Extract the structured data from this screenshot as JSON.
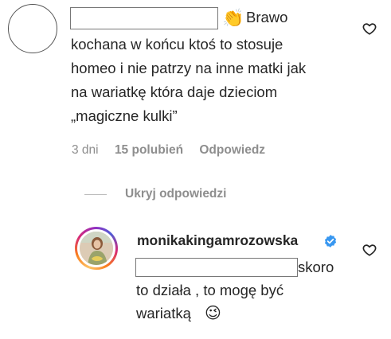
{
  "comment": {
    "redacted_username": "",
    "emoji": "👏",
    "text_line1_tail": "Brawo",
    "text_lines": [
      "kochana w końcu ktoś to stosuje",
      "homeo i nie patrzy na inne matki jak",
      "na wariatkę która daje dzieciom",
      "„magiczne kulki”"
    ],
    "time": "3 dni",
    "likes": "15 polubień",
    "reply_label": "Odpowiedz"
  },
  "toggle_replies": "Ukryj odpowiedzi",
  "reply": {
    "username": "monikakingamrozowska",
    "verified": true,
    "text_line1_tail": "skoro",
    "text_lines": [
      "to działa , to mogę być",
      "wariatką"
    ],
    "emoji": "😉"
  },
  "icons": {
    "like": "heart-outline-icon",
    "verified": "verified-badge-icon"
  },
  "colors": {
    "text": "#262626",
    "meta": "#8e8e8e",
    "verified": "#3897f0"
  }
}
